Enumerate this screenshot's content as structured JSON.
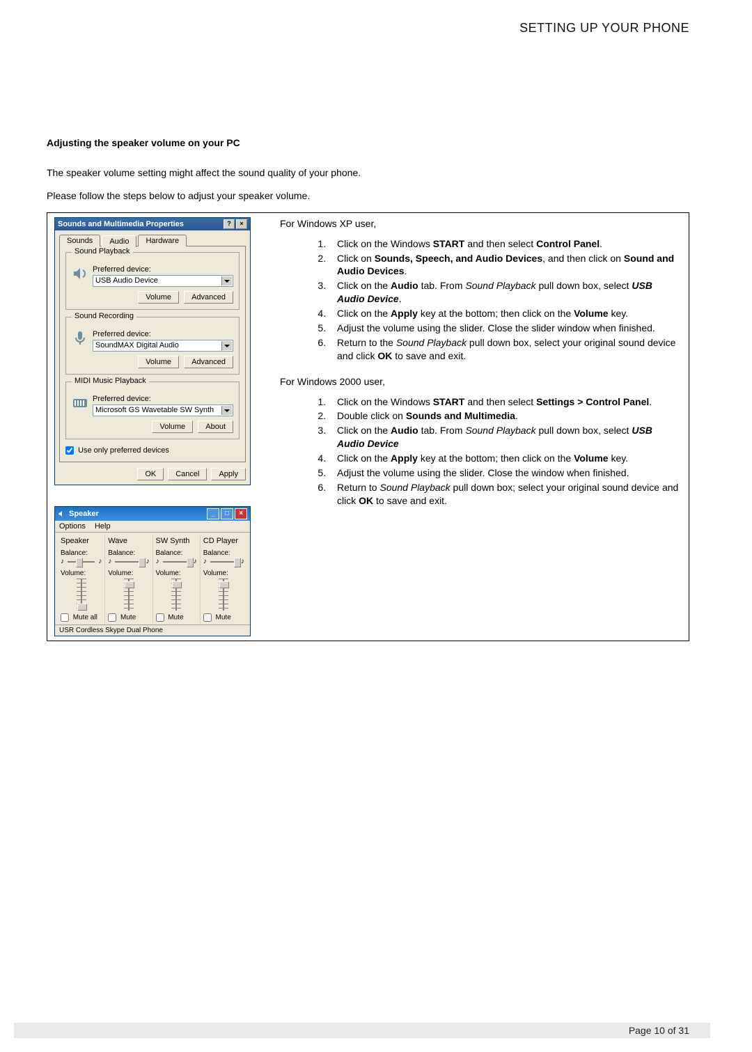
{
  "header": "SETTING UP YOUR PHONE",
  "sec_title": "Adjusting the speaker volume on your PC",
  "para1": "The speaker volume setting might affect the sound quality of your phone.",
  "para2": "Please follow the steps below to adjust your speaker volume.",
  "dialog": {
    "title": "Sounds and Multimedia Properties",
    "help_btn": "?",
    "close_btn": "×",
    "tabs": {
      "sounds": "Sounds",
      "audio": "Audio",
      "hardware": "Hardware"
    },
    "playback": {
      "legend": "Sound Playback",
      "pref_label": "Preferred device:",
      "device": "USB Audio Device",
      "volume_btn": "Volume",
      "advanced_btn": "Advanced"
    },
    "recording": {
      "legend": "Sound Recording",
      "pref_label": "Preferred device:",
      "device": "SoundMAX Digital Audio",
      "volume_btn": "Volume",
      "advanced_btn": "Advanced"
    },
    "midi": {
      "legend": "MIDI Music Playback",
      "pref_label": "Preferred device:",
      "device": "Microsoft GS Wavetable SW Synth",
      "volume_btn": "Volume",
      "about_btn": "About"
    },
    "use_only_pref": "Use only preferred devices",
    "ok_btn": "OK",
    "cancel_btn": "Cancel",
    "apply_btn": "Apply"
  },
  "mixer": {
    "title": "Speaker",
    "menu_options": "Options",
    "menu_help": "Help",
    "cols": [
      {
        "title": "Speaker",
        "balance": "Balance:",
        "volume": "Volume:",
        "mute": "Mute all"
      },
      {
        "title": "Wave",
        "balance": "Balance:",
        "volume": "Volume:",
        "mute": "Mute"
      },
      {
        "title": "SW Synth",
        "balance": "Balance:",
        "volume": "Volume:",
        "mute": "Mute"
      },
      {
        "title": "CD Player",
        "balance": "Balance:",
        "volume": "Volume:",
        "mute": "Mute"
      }
    ],
    "status": "USR Cordless Skype Dual Phone"
  },
  "xp_heading": "For Windows XP user,",
  "xp_steps_html": [
    "Click on the Windows <b>START</b> and then select <b>Control Panel</b>.",
    "Click on <b>Sounds, Speech, and Audio Devices</b>, and then click on <b>Sound and Audio Devices</b>.",
    "Click on the <b>Audio</b> tab.  From <i>Sound Playback</i> pull down box, select <b><i>USB Audio Device</i></b>.",
    "Click on the <b>Apply</b> key at the bottom; then click on the <b>Volume</b> key.",
    "Adjust the volume using the slider.  Close the slider window when finished.",
    "Return to the <i>Sound Playback</i> pull down box, select your original sound device and click <b>OK</b> to save and exit."
  ],
  "w2k_heading": "For Windows 2000 user,",
  "w2k_steps_html": [
    "Click on the Windows <b>START</b> and then select <b>Settings &gt; Control Panel</b>.",
    "Double click on <b>Sounds and Multimedia</b>.",
    "Click on the <b>Audio</b> tab.  From <i>Sound Playback</i> pull down box, select <b><i>USB Audio Device</i></b>",
    "Click on the <b>Apply</b> key at the bottom; then click on the <b>Volume</b> key.",
    "Adjust the volume using the slider. Close the window when finished.",
    "Return to <i>Sound Playback</i> pull down box; select your original sound device and click <b>OK</b> to save and exit."
  ],
  "footer": "Page 10 of 31"
}
